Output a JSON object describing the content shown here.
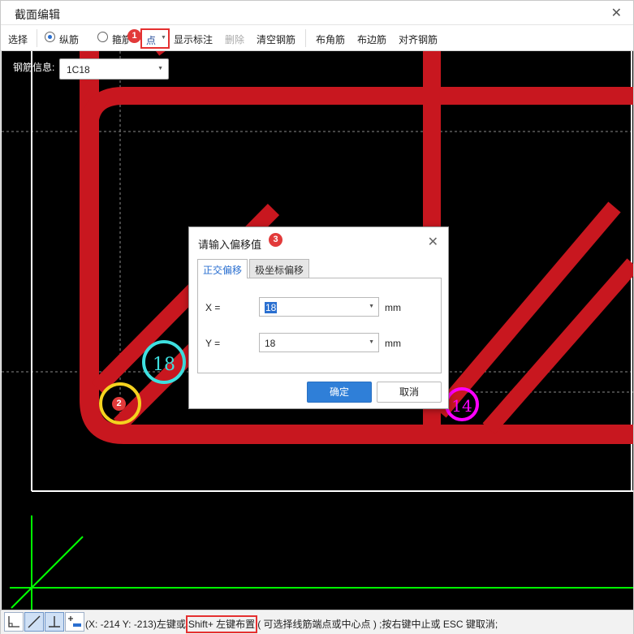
{
  "window": {
    "title": "截面编辑",
    "close_icon": "close-icon"
  },
  "toolbar": {
    "select_label": "选择",
    "radio_longitudinal": "纵筋",
    "radio_stirrup": "箍筋",
    "point_dropdown": "点",
    "show_annotation": "显示标注",
    "delete": "删除",
    "clear_rebar": "清空钢筋",
    "corner_rebar": "布角筋",
    "side_rebar": "布边筋",
    "align_rebar": "对齐钢筋"
  },
  "rebar_info": {
    "label": "钢筋信息:",
    "value": "1C18"
  },
  "canvas": {
    "marker_cyan": "18",
    "marker_magenta": "14",
    "colors": {
      "background": "#000000",
      "rebar": "#c8171f",
      "grid_line": "#ffffff",
      "axis": "#00ff00",
      "marker_cyan": "#3ee0e0",
      "marker_yellow": "#f5d21f",
      "marker_magenta": "#ff00ff"
    }
  },
  "steps": {
    "step1": "1",
    "step2": "2",
    "step3": "3"
  },
  "dialog": {
    "title": "请输入偏移值",
    "tabs": [
      {
        "label": "正交偏移",
        "active": true
      },
      {
        "label": "极坐标偏移",
        "active": false
      }
    ],
    "x_label": "X =",
    "x_value": "18",
    "y_label": "Y =",
    "y_value": "18",
    "unit": "mm",
    "ok": "确定",
    "cancel": "取消"
  },
  "statusbar": {
    "coords": "(X: -214 Y: -213)左键或",
    "highlight": "Shift+ 左键布置",
    "rest": "( 可选择线筋端点或中心点 ) ;按右键中止或 ESC 键取消;"
  }
}
